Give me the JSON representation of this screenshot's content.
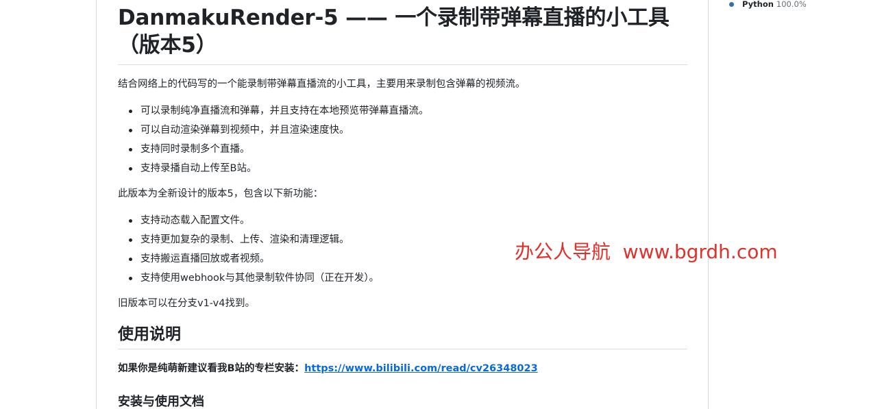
{
  "sidebar": {
    "language": {
      "name": "Python",
      "percent": "100.0%",
      "color": "#3572A5"
    }
  },
  "readme": {
    "title": "DanmakuRender-5 —— 一个录制带弹幕直播的小工具（版本5）",
    "intro": "结合网络上的代码写的一个能录制带弹幕直播流的小工具，主要用来录制包含弹幕的视频流。",
    "features": [
      "可以录制纯净直播流和弹幕，并且支持在本地预览带弹幕直播流。",
      "可以自动渲染弹幕到视频中，并且渲染速度快。",
      "支持同时录制多个直播。",
      "支持录播自动上传至B站。"
    ],
    "version_intro": "此版本为全新设计的版本5，包含以下新功能：",
    "new_features": [
      "支持动态载入配置文件。",
      "支持更加复杂的录制、上传、渲染和清理逻辑。",
      "支持搬运直播回放或者视频。",
      "支持使用webhook与其他录制软件协同（正在开发）。"
    ],
    "old_versions": "旧版本可以在分支v1-v4找到。",
    "usage_heading": "使用说明",
    "newbie_prefix": "如果你是纯萌新建议看我B站的专栏安装：",
    "newbie_link": "https://www.bilibili.com/read/cv26348023",
    "next_heading": "安装与使用文档"
  },
  "watermark": {
    "text": "办公人导航  www.bgrdh.com",
    "color": "#e0302a"
  }
}
